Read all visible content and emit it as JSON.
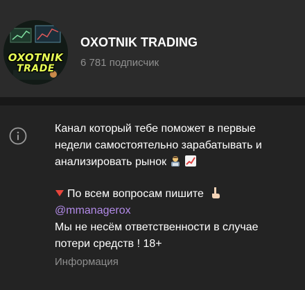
{
  "channel": {
    "title": "OXOTNIK TRADING",
    "subscribers": "6 781 подписчик",
    "avatar_text": [
      "OXOTNIK",
      "TRADE"
    ]
  },
  "about": {
    "line1": "Канал который тебе поможет в первые",
    "line2": "недели самостоятельно зарабатывать и",
    "line3": "анализировать рынок",
    "line4": "По всем вопросам пишите",
    "link": "@mmanagerox",
    "line5": "Мы не несём ответственности в случае",
    "line6": "потери средств ! 18+",
    "label": "Информация"
  },
  "icons": {
    "info": "info-icon",
    "emoji1": "man-technologist-emoji",
    "emoji2": "chart-increasing-emoji",
    "emoji3": "red-triangle-down-emoji",
    "emoji4": "pointing-down-emoji"
  },
  "colors": {
    "background": "#232323",
    "header": "#2b2b2b",
    "link": "#b28ae8",
    "muted": "#8f8f8f"
  }
}
